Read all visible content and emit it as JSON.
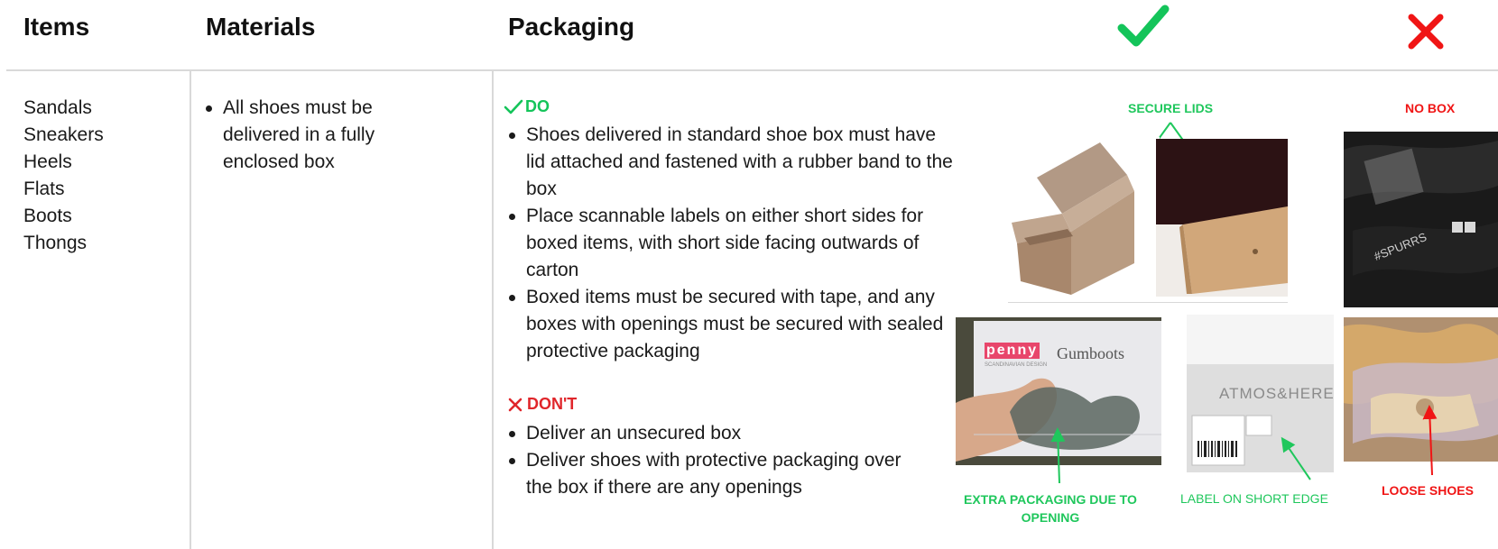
{
  "header": {
    "items": "Items",
    "materials": "Materials",
    "packaging": "Packaging"
  },
  "items_list": [
    "Sandals",
    "Sneakers",
    "Heels",
    "Flats",
    "Boots",
    "Thongs"
  ],
  "materials_list": [
    "All shoes must be delivered in a fully enclosed box"
  ],
  "packaging": {
    "do_label": "DO",
    "do_items": [
      "Shoes delivered in standard shoe box must have lid attached and fastened with a rubber band to the box",
      "Place scannable labels on either short sides for boxed items, with short side facing outwards of carton",
      "Boxed items must be secured with tape, and any boxes with openings must be secured with sealed protective packaging"
    ],
    "dont_label": "DON'T",
    "dont_items": [
      "Deliver an unsecured box",
      "Deliver shoes with protective packaging over the box if there are any openings"
    ]
  },
  "captions": {
    "secure_lids": "SECURE LIDS",
    "no_box": "NO BOX",
    "extra_packaging_line1": "EXTRA PACKAGING DUE TO",
    "extra_packaging_line2": "OPENING",
    "label_short_edge": "LABEL ON SHORT EDGE",
    "loose_shoes": "LOOSE SHOES"
  },
  "photo_text": {
    "brand_penny": "penny",
    "brand_penny_sub": "SCANDINAVIAN DESIGN",
    "gumboots": "Gumboots",
    "atmos": "ATMOS&HERE",
    "spurrs": "#SPURRS"
  },
  "colors": {
    "check_green": "#14c45a",
    "cross_red": "#e0262b",
    "divider": "#d9d9d9"
  },
  "icons": [
    "check-icon",
    "cross-icon"
  ]
}
